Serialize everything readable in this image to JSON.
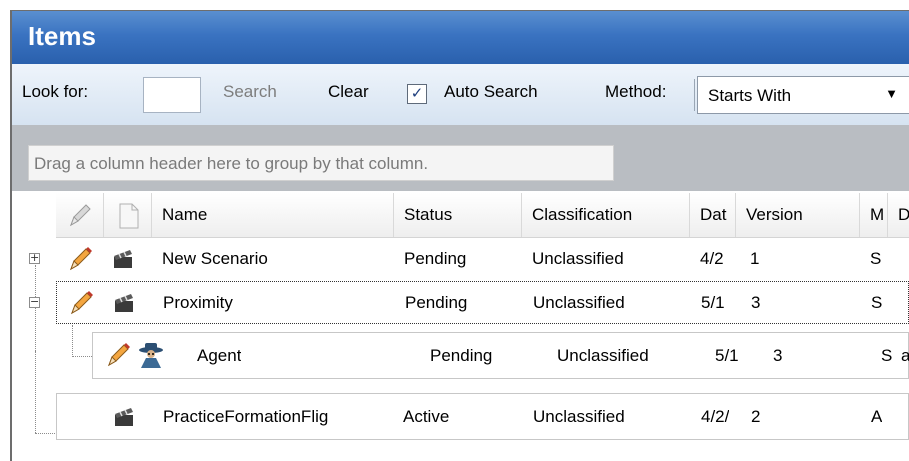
{
  "window": {
    "title": "Items"
  },
  "toolbar": {
    "look_for_label": "Look for:",
    "search_value": "",
    "search_label": "Search",
    "clear_label": "Clear",
    "auto_search_label": "Auto Search",
    "auto_search_checked": true,
    "method_label": "Method:",
    "method_value": "Starts With"
  },
  "group_panel": {
    "hint": "Drag a column header here to group by that column."
  },
  "grid": {
    "columns": [
      "Name",
      "Status",
      "Classification",
      "Dat",
      "Version",
      "M",
      "D"
    ],
    "rows": [
      {
        "name": "New Scenario",
        "status": "Pending",
        "classification": "Unclassified",
        "date": "4/2",
        "version": "1",
        "m": "S",
        "d": "",
        "icon": "clapperboard-icon",
        "editable": true,
        "expander": "+"
      },
      {
        "name": "Proximity",
        "status": "Pending",
        "classification": "Unclassified",
        "date": "5/1",
        "version": "3",
        "m": "S",
        "d": "",
        "icon": "clapperboard-icon",
        "editable": true,
        "expander": "−"
      },
      {
        "name": "Agent",
        "status": "Pending",
        "classification": "Unclassified",
        "date": "5/1",
        "version": "3",
        "m": "S",
        "d": "a",
        "icon": "agent-icon",
        "editable": true
      },
      {
        "name": "PracticeFormationFlig",
        "status": "Active",
        "classification": "Unclassified",
        "date": "4/2/",
        "version": "2",
        "m": "A",
        "d": "",
        "icon": "clapperboard-icon",
        "editable": false
      }
    ]
  }
}
